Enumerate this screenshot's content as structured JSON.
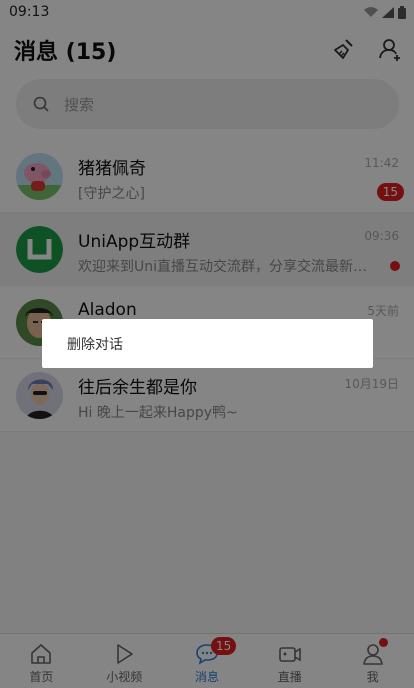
{
  "status_bar": {
    "time": "09:13"
  },
  "header": {
    "title": "消息 (15)"
  },
  "search": {
    "placeholder": "搜索"
  },
  "conversations": [
    {
      "name": "猪猪佩奇",
      "preview": "[守护之心]",
      "time": "11:42",
      "badge": "15"
    },
    {
      "name": "UniApp互动群",
      "preview": "欢迎来到Uni直播互动交流群，分享交流最新动态",
      "time": "09:36",
      "unread_dot": true
    },
    {
      "name": "Aladon",
      "preview": "",
      "time": "5天前"
    },
    {
      "name": "往后余生都是你",
      "preview": "Hi 晚上一起来Happy鸭~",
      "time": "10月19日"
    }
  ],
  "tabbar": {
    "items": [
      {
        "label": "首页",
        "icon": "home-icon"
      },
      {
        "label": "小视频",
        "icon": "play-icon"
      },
      {
        "label": "消息",
        "icon": "chat-icon",
        "badge": "15",
        "active": true
      },
      {
        "label": "直播",
        "icon": "camera-icon"
      },
      {
        "label": "我",
        "icon": "user-icon",
        "dot": true
      }
    ]
  },
  "context_menu": {
    "item": "删除对话"
  },
  "colors": {
    "accent": "#2b7fd8",
    "badge": "#e02020",
    "group_avatar": "#1a9c46"
  }
}
